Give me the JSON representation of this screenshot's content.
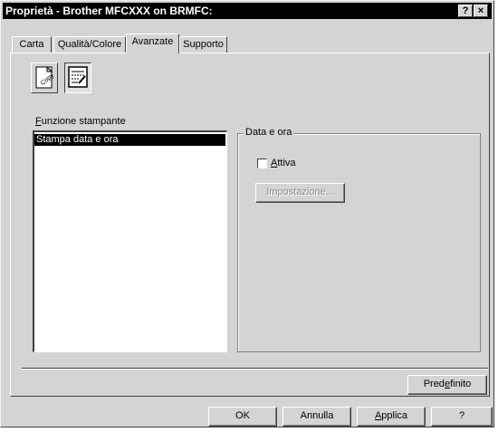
{
  "window": {
    "title": "Proprietà - Brother MFCXXX on BRMFC:",
    "help_glyph": "?",
    "close_glyph": "×"
  },
  "tabs": [
    {
      "label": "Carta",
      "active": false
    },
    {
      "label": "Qualità/Colore",
      "active": false
    },
    {
      "label": "Avanzate",
      "active": true
    },
    {
      "label": "Supporto",
      "active": false
    }
  ],
  "toolbar_icons": [
    {
      "name": "copy-icon",
      "text": "Copy",
      "pressed": false
    },
    {
      "name": "print-settings-icon",
      "text": "",
      "pressed": true
    }
  ],
  "functions": {
    "label_first": "F",
    "label_rest": "unzione stampante",
    "items": [
      "Stampa data e ora"
    ],
    "selected": "Stampa data e ora"
  },
  "date_group": {
    "title": "Data e ora",
    "checkbox_first": "A",
    "checkbox_rest": "ttiva",
    "checked": false,
    "settings_button": "Impostazione..."
  },
  "predefinito": {
    "pre": "Pred",
    "key": "e",
    "post": "finito"
  },
  "footer": {
    "ok": "OK",
    "cancel": "Annulla",
    "apply_first": "A",
    "apply_rest": "pplica",
    "help": "?"
  }
}
